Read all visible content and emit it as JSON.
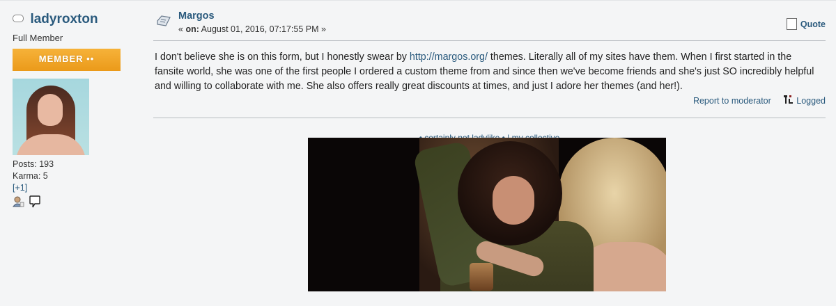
{
  "poster": {
    "name": "ladyroxton",
    "rank": "Full Member",
    "badge": "MEMBER ••",
    "stats": {
      "posts": "Posts: 193",
      "karma": "Karma: 5",
      "karma_action": "[+1]"
    },
    "icons": [
      "profile-icon",
      "message-icon"
    ]
  },
  "post": {
    "subject": "Margos",
    "date_prefix": "« ",
    "date_on": "on:",
    "date_value": " August 01, 2016, 07:17:55 PM »",
    "quote_label": "Quote",
    "body_part1": "I don't believe she is on this form, but I honestly swear by ",
    "body_link": "http://margos.org/",
    "body_part2": " themes. Literally all of my sites have them. When I first started in the fansite world, she was one of the first people I ordered a custom theme from and since then we've become friends and she's just SO incredibly helpful and willing to collaborate with me. She also offers really great discounts at times, and just I adore her themes (and her!).",
    "report_label": "Report to moderator",
    "logged_label": "Logged"
  },
  "signature": {
    "links_text": "• certainly not ladylike • | my collective"
  },
  "colors": {
    "link": "#2a5a7d",
    "badge_orange": "#f0a62a",
    "background": "#f4f5f6"
  }
}
